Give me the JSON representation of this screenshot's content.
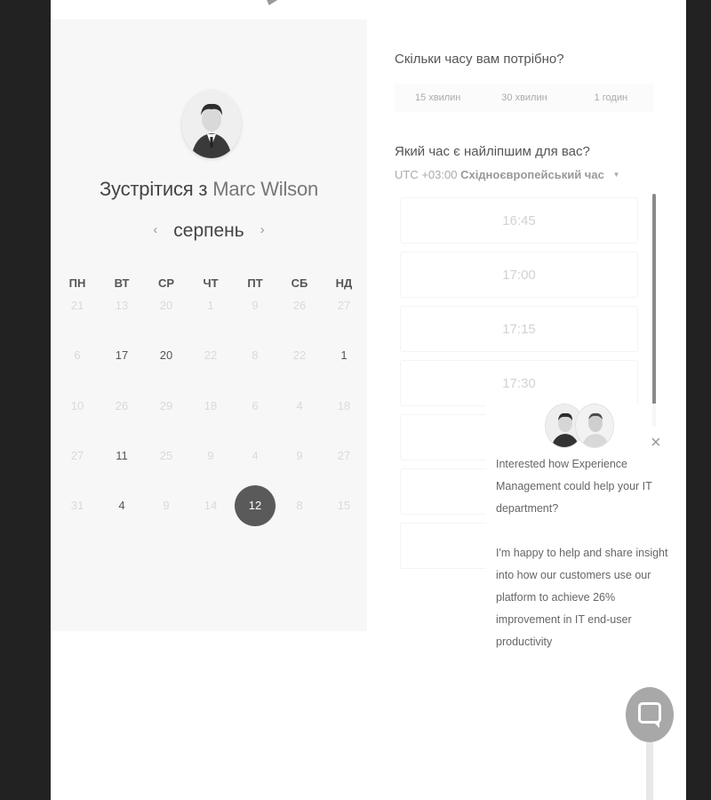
{
  "calendar": {
    "title_prefix": "Зустрітися з",
    "host_name": "Marc Wilson",
    "month": "серпень",
    "prev_arrow": "‹",
    "next_arrow": "›",
    "weekdays": [
      "ПН",
      "ВТ",
      "СР",
      "ЧТ",
      "ПТ",
      "СБ",
      "НД"
    ],
    "weeks": [
      [
        {
          "d": "21",
          "s": "off"
        },
        {
          "d": "13",
          "s": "off"
        },
        {
          "d": "20",
          "s": "off"
        },
        {
          "d": "1",
          "s": "off"
        },
        {
          "d": "9",
          "s": "off"
        },
        {
          "d": "26",
          "s": "off"
        },
        {
          "d": "27",
          "s": "off"
        }
      ],
      [
        {
          "d": "6",
          "s": "off"
        },
        {
          "d": "17",
          "s": "on"
        },
        {
          "d": "20",
          "s": "on"
        },
        {
          "d": "22",
          "s": "off"
        },
        {
          "d": "8",
          "s": "off"
        },
        {
          "d": "22",
          "s": "off"
        },
        {
          "d": "1",
          "s": "on"
        }
      ],
      [
        {
          "d": "10",
          "s": "off"
        },
        {
          "d": "26",
          "s": "off"
        },
        {
          "d": "29",
          "s": "off"
        },
        {
          "d": "18",
          "s": "off"
        },
        {
          "d": "6",
          "s": "off"
        },
        {
          "d": "4",
          "s": "off"
        },
        {
          "d": "18",
          "s": "off"
        }
      ],
      [
        {
          "d": "27",
          "s": "off"
        },
        {
          "d": "11",
          "s": "on"
        },
        {
          "d": "25",
          "s": "off"
        },
        {
          "d": "9",
          "s": "off"
        },
        {
          "d": "4",
          "s": "off"
        },
        {
          "d": "9",
          "s": "off"
        },
        {
          "d": "27",
          "s": "off"
        }
      ],
      [
        {
          "d": "31",
          "s": "off"
        },
        {
          "d": "4",
          "s": "on"
        },
        {
          "d": "9",
          "s": "off"
        },
        {
          "d": "14",
          "s": "off"
        },
        {
          "d": "12",
          "s": "sel"
        },
        {
          "d": "8",
          "s": "off"
        },
        {
          "d": "15",
          "s": "off"
        }
      ]
    ]
  },
  "booking": {
    "duration_question": "Скільки часу вам потрібно?",
    "durations": [
      "15 хвилин",
      "30 хвилин",
      "1 годин"
    ],
    "time_question": "Який час є найліпшим для вас?",
    "timezone_offset": "UTC +03:00",
    "timezone_name": "Східноєвропейський час",
    "slots": [
      "16:45",
      "17:00",
      "17:15",
      "17:30",
      "",
      "",
      ""
    ]
  },
  "chat": {
    "paragraph1": "Interested how Experience Management could help your IT department?",
    "paragraph2": "I'm happy to help and share insight into how our customers use our platform to achieve 26% improvement in IT end-user productivity",
    "close_icon": "close-icon",
    "launcher_icon": "chat-bubble-icon"
  }
}
